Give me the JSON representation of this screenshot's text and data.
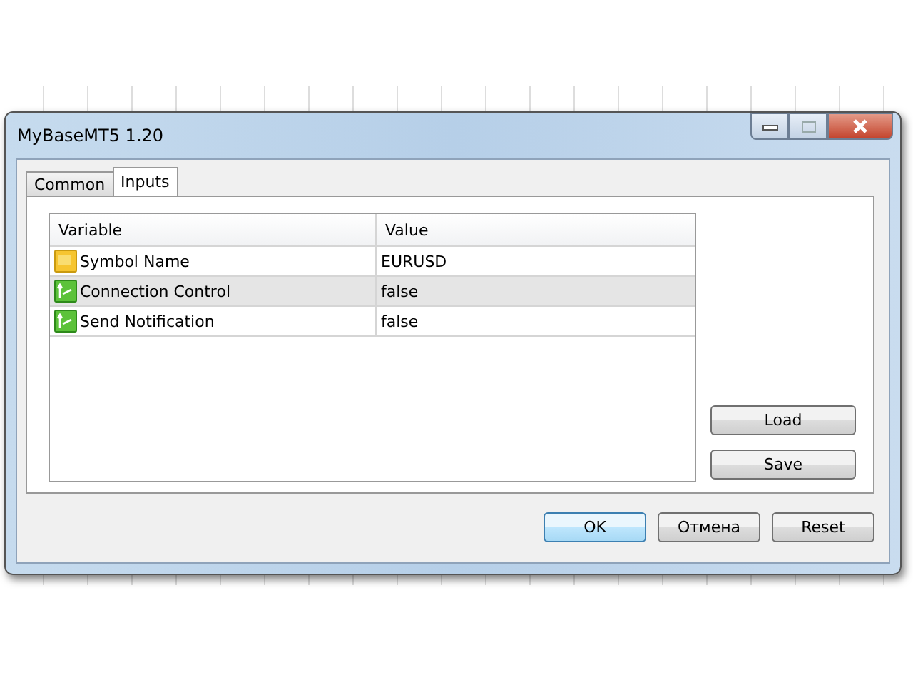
{
  "window": {
    "title": "MyBaseMT5 1.20"
  },
  "tabs": [
    {
      "label": "Common",
      "selected": false
    },
    {
      "label": "Inputs",
      "selected": true
    }
  ],
  "table": {
    "columns": [
      "Variable",
      "Value"
    ],
    "rows": [
      {
        "kind": "string",
        "variable": "Symbol Name",
        "value": "EURUSD",
        "selected": false
      },
      {
        "kind": "bool",
        "variable": "Connection Control",
        "value": "false",
        "selected": true
      },
      {
        "kind": "bool",
        "variable": "Send Notification",
        "value": "false",
        "selected": false
      }
    ]
  },
  "side_buttons": [
    "Load",
    "Save"
  ],
  "buttons": [
    {
      "label": "OK",
      "default": true
    },
    {
      "label": "Отмена",
      "default": false
    },
    {
      "label": "Reset",
      "default": false
    }
  ]
}
